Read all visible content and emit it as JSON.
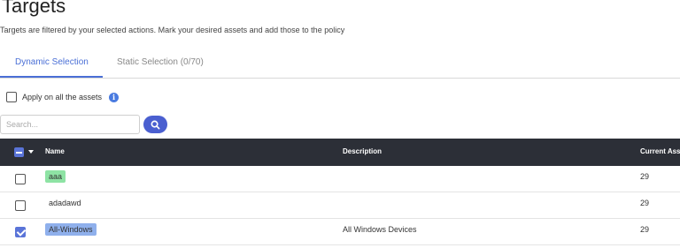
{
  "header": {
    "title": "Targets",
    "subtitle": "Targets are filtered by your selected actions. Mark your desired assets and add those to the policy"
  },
  "tabs": [
    {
      "label": "Dynamic Selection",
      "active": true
    },
    {
      "label": "Static Selection (0/70)",
      "active": false
    }
  ],
  "apply_all": {
    "label": "Apply on all the assets",
    "checked": false,
    "info_icon": "info-icon"
  },
  "search": {
    "placeholder": "Search...",
    "value": "",
    "button_icon": "search-icon"
  },
  "table": {
    "columns": [
      "Name",
      "Description",
      "Current Assets"
    ],
    "header_select": {
      "state": "indeterminate",
      "dropdown_icon": "caret-down-icon"
    },
    "rows": [
      {
        "name": "aaa",
        "description": "",
        "current_assets": "29",
        "checked": false,
        "tag_color": "#8ee3a4"
      },
      {
        "name": "adadawd",
        "description": "",
        "current_assets": "29",
        "checked": false,
        "tag_color": ""
      },
      {
        "name": "All-Windows",
        "description": "All Windows Devices",
        "current_assets": "29",
        "checked": true,
        "tag_color": "#8fb0ec"
      }
    ]
  },
  "colors": {
    "accent": "#4a6fd6",
    "header_bg": "#2c2f37",
    "search_button": "#4a5fd0"
  }
}
